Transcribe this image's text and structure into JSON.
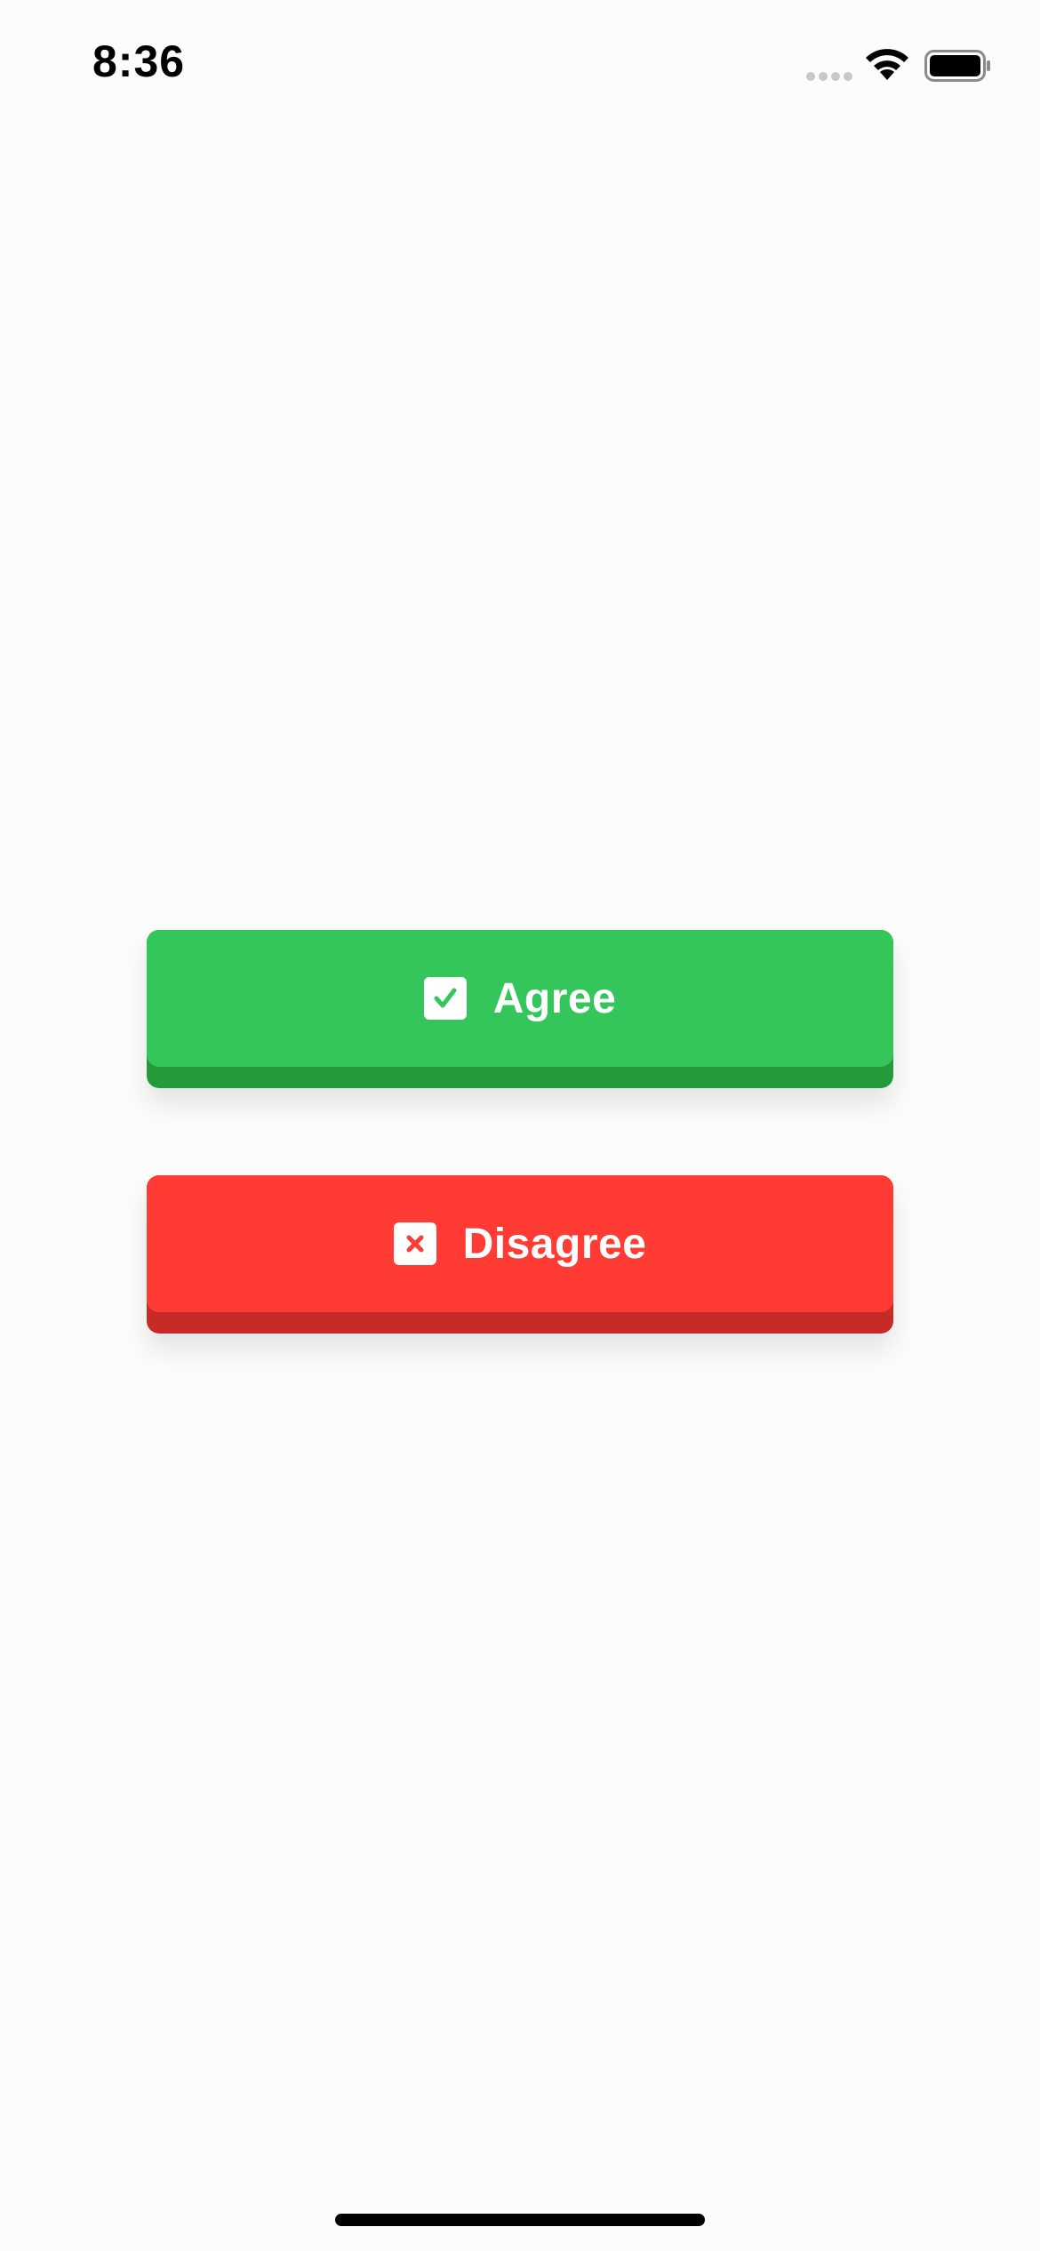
{
  "status_bar": {
    "time": "8:36",
    "icons": [
      "signal-icon",
      "wifi-icon",
      "battery-icon"
    ]
  },
  "buttons": {
    "agree": {
      "label": "Agree",
      "icon": "checkbox-checked-icon",
      "color": "#34c65a",
      "shadow_color": "#259a3d"
    },
    "disagree": {
      "label": "Disagree",
      "icon": "close-box-icon",
      "color": "#ff3b33",
      "shadow_color": "#c72b27"
    }
  },
  "colors": {
    "background": "#fcfcfb"
  }
}
